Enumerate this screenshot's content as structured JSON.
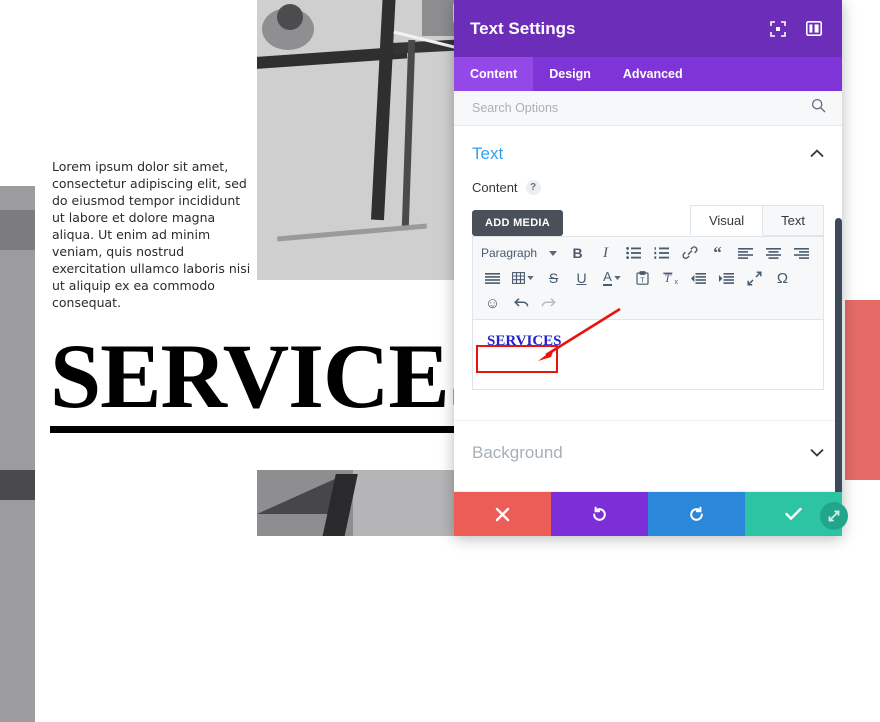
{
  "page": {
    "body_text": "Lorem ipsum dolor sit amet, consectetur adipiscing elit, sed do eiusmod tempor incididunt ut labore et dolore magna aliqua. Ut enim ad minim veniam, quis nostrud exercitation ullamco laboris nisi ut aliquip ex ea commodo consequat.",
    "heading": "SERVICES"
  },
  "modal": {
    "title": "Text Settings",
    "header_icons": [
      {
        "name": "focus-target-icon",
        "glyph": "⬚"
      },
      {
        "name": "layout-panel-icon",
        "glyph": "▤"
      }
    ],
    "tabs": [
      {
        "label": "Content",
        "active": true
      },
      {
        "label": "Design",
        "active": false
      },
      {
        "label": "Advanced",
        "active": false
      }
    ],
    "search": {
      "placeholder": "Search Options",
      "value": "",
      "icon": "search-icon"
    },
    "sections": [
      {
        "title": "Text",
        "expanded": true,
        "chevron": "chevron-up-icon"
      },
      {
        "title": "Background",
        "expanded": false,
        "chevron": "chevron-down-icon"
      }
    ],
    "content_field": {
      "label": "Content",
      "help": "?",
      "add_media_label": "ADD MEDIA",
      "editor_tabs": [
        {
          "label": "Visual",
          "active": true
        },
        {
          "label": "Text",
          "active": false
        }
      ],
      "format_select": "Paragraph",
      "editor_html_text": "SERVICES"
    },
    "toolbar_rows": [
      [
        {
          "name": "format-select",
          "label": "Paragraph",
          "type": "select"
        },
        {
          "name": "bold-icon",
          "glyph": "B"
        },
        {
          "name": "italic-icon",
          "glyph": "I"
        },
        {
          "name": "bulleted-list-icon",
          "glyph": "☰"
        },
        {
          "name": "numbered-list-icon",
          "glyph": "☰"
        },
        {
          "name": "link-icon",
          "glyph": "🔗"
        },
        {
          "name": "blockquote-icon",
          "glyph": "“"
        },
        {
          "name": "align-left-icon",
          "glyph": "≡"
        }
      ],
      [
        {
          "name": "align-center-icon",
          "glyph": "≡"
        },
        {
          "name": "align-right-icon",
          "glyph": "≡"
        },
        {
          "name": "align-justify-icon",
          "glyph": "≡"
        },
        {
          "name": "table-icon",
          "glyph": "☷"
        },
        {
          "name": "strikethrough-icon",
          "glyph": "S"
        },
        {
          "name": "underline-icon",
          "glyph": "U"
        },
        {
          "name": "text-color-icon",
          "glyph": "A"
        },
        {
          "name": "paste-as-text-icon",
          "glyph": "📋"
        },
        {
          "name": "clear-formatting-icon",
          "glyph": "Tx"
        },
        {
          "name": "outdent-icon",
          "glyph": "⇤"
        }
      ],
      [
        {
          "name": "indent-icon",
          "glyph": "⇥"
        },
        {
          "name": "fullscreen-icon",
          "glyph": "⤢"
        },
        {
          "name": "special-character-icon",
          "glyph": "Ω"
        },
        {
          "name": "emoji-icon",
          "glyph": "☺"
        },
        {
          "name": "undo-icon",
          "glyph": "↶"
        },
        {
          "name": "redo-icon",
          "glyph": "↷",
          "disabled": true
        }
      ]
    ],
    "actions": [
      {
        "name": "cancel-button",
        "glyph": "✖",
        "color": "#eb5d56"
      },
      {
        "name": "undo-button",
        "glyph": "↺",
        "color": "#7c2fd6"
      },
      {
        "name": "redo-button",
        "glyph": "↻",
        "color": "#2b87da"
      },
      {
        "name": "save-button",
        "glyph": "✔",
        "color": "#2cc4a2"
      }
    ]
  },
  "annotation": {
    "type": "red-arrow-and-box",
    "target": "SERVICES",
    "color": "#e8130f"
  },
  "colors": {
    "header_purple": "#6c2eb9",
    "tab_purple": "#7e34d6",
    "tab_active_purple": "#9548e8",
    "section_blue": "#2ea3f2",
    "link_blue": "#2222cc"
  }
}
